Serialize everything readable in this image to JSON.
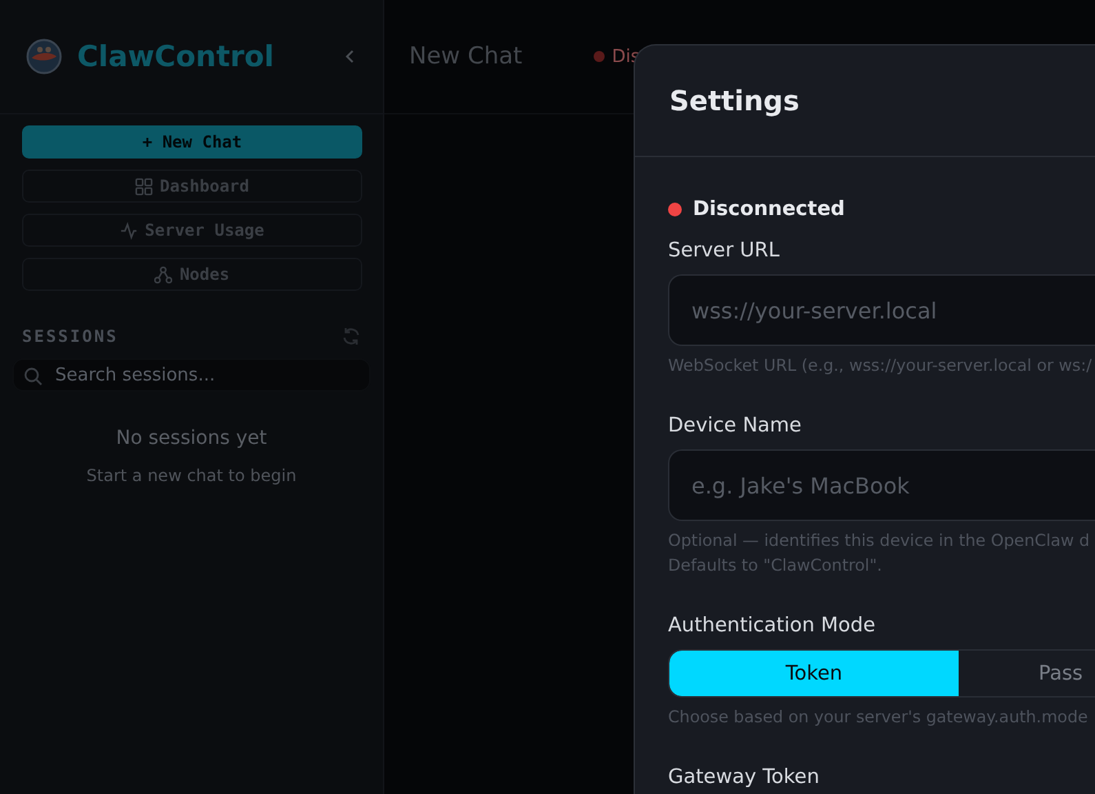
{
  "sidebar": {
    "app_name": "ClawControl",
    "nav": [
      {
        "label": "+ New Chat",
        "kind": "primary"
      },
      {
        "label": "Dashboard",
        "kind": "dashboard"
      },
      {
        "label": "Server Usage",
        "kind": "usage"
      },
      {
        "label": "Nodes",
        "kind": "nodes"
      }
    ],
    "sessions": {
      "heading": "SESSIONS",
      "search_placeholder": "Search sessions...",
      "empty_title": "No sessions yet",
      "empty_hint": "Start a new chat to begin"
    }
  },
  "header": {
    "title": "New Chat",
    "status": {
      "label": "Dis",
      "color": "#5a1a1a"
    }
  },
  "settings": {
    "title": "Settings",
    "status": {
      "label": "Disconnected",
      "color": "#ef4444"
    },
    "fields": [
      {
        "kind": "text",
        "label": "Server URL",
        "placeholder": "wss://your-server.local",
        "help": [
          "WebSocket URL (e.g., wss://your-server.local or ws:/"
        ]
      },
      {
        "kind": "text",
        "label": "Device Name",
        "placeholder": "e.g. Jake's MacBook",
        "help": [
          "Optional — identifies this device in the OpenClaw d",
          "Defaults to \"ClawControl\"."
        ]
      },
      {
        "kind": "segmented",
        "label": "Authentication Mode",
        "options": [
          {
            "label": "Token",
            "selected": true
          },
          {
            "label": "Pass",
            "selected": false
          }
        ],
        "help": [
          "Choose based on your server's gateway.auth.mode"
        ]
      },
      {
        "kind": "heading",
        "label": "Gateway Token"
      }
    ]
  }
}
